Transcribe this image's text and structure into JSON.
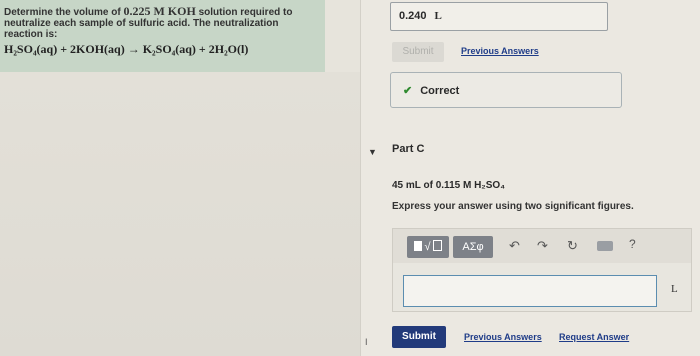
{
  "question": {
    "line1_prefix": "Determine the volume of ",
    "line1_conc": "0.225 M KOH",
    "line1_suffix": " solution required to",
    "line2": "neutralize each sample of sulfuric acid. The neutralization",
    "line3": "reaction is:",
    "equation": "H₂SO₄(aq) + 2KOH(aq) → K₂SO₄(aq) + 2H₂O(l)"
  },
  "part_b": {
    "answer_value": "0.240",
    "answer_unit": "L",
    "submit_label": "Submit",
    "previous_answers_label": "Previous Answers",
    "feedback_label": "Correct"
  },
  "part_c": {
    "title": "Part C",
    "sample_text": "45 mL of 0.115 M H₂SO₄",
    "instruction": "Express your answer using two significant figures.",
    "toolbar": {
      "templates_label": "√",
      "symbols_label": "ΑΣφ",
      "help_label": "?"
    },
    "input_value": "",
    "input_unit": "L",
    "submit_label": "Submit",
    "previous_answers_label": "Previous Answers",
    "request_answer_label": "Request Answer"
  },
  "colors": {
    "question_panel_bg": "#c7d6c7",
    "link": "#1f3c88",
    "submit_bg": "#223a7a",
    "check": "#2f8a2f",
    "input_border": "#5b8db0"
  },
  "icons": [
    "undo-icon",
    "redo-icon",
    "reset-icon",
    "keyboard-icon",
    "help-icon",
    "check-icon",
    "caret-down-icon",
    "cursor-icon"
  ]
}
